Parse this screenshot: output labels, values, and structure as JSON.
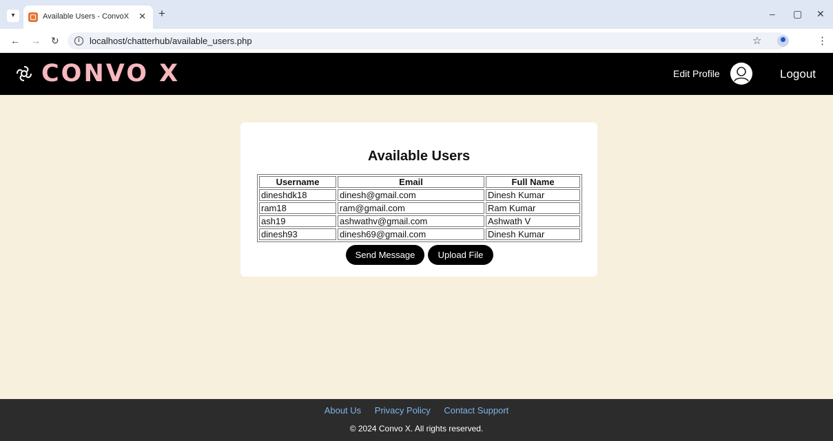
{
  "browser": {
    "tab_title": "Available Users - ConvoX",
    "url": "localhost/chatterhub/available_users.php"
  },
  "header": {
    "logo": "CONVO X",
    "edit_profile": "Edit Profile",
    "logout": "Logout"
  },
  "main": {
    "title": "Available Users",
    "columns": [
      "Username",
      "Email",
      "Full Name"
    ],
    "rows": [
      [
        "dineshdk18",
        "dinesh@gmail.com",
        "Dinesh Kumar"
      ],
      [
        "ram18",
        "ram@gmail.com",
        "Ram Kumar"
      ],
      [
        "ash19",
        "ashwathv@gmail.com",
        "Ashwath V"
      ],
      [
        "dinesh93",
        "dinesh69@gmail.com",
        "Dinesh Kumar"
      ]
    ],
    "send_message": "Send Message",
    "upload_file": "Upload File"
  },
  "footer": {
    "links": [
      "About Us",
      "Privacy Policy",
      "Contact Support"
    ],
    "copyright": "© 2024 Convo X. All rights reserved."
  },
  "colors": {
    "page_bg": "#f7f0dc",
    "header_bg": "#000000",
    "logo": "#f6b7bf",
    "footer_bg": "#2c2c2c",
    "footer_link": "#7fb3ea"
  }
}
